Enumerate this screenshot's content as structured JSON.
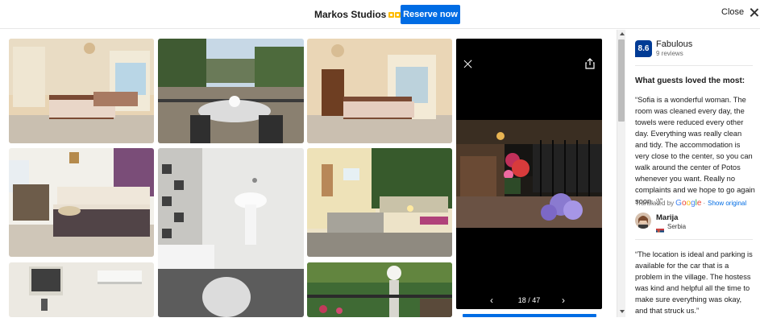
{
  "header": {
    "property_name": "Markos Studios",
    "star_rating": 3,
    "reserve_label": "Reserve now",
    "close_label": "Close"
  },
  "gallery": {
    "photos": [
      {
        "name": "photo-bedroom-1",
        "subject": "bedroom with curtains"
      },
      {
        "name": "photo-balcony",
        "subject": "balcony with tea set and hills"
      },
      {
        "name": "photo-bedroom-2",
        "subject": "bedroom with chandelier"
      },
      {
        "name": "photo-bedroom-3",
        "subject": "bedroom with floral bedding"
      },
      {
        "name": "photo-bathroom",
        "subject": "bathroom with sink and shower"
      },
      {
        "name": "photo-entrance",
        "subject": "entrance steps at night"
      },
      {
        "name": "photo-tv-room",
        "subject": "room with tv and air conditioner"
      },
      {
        "name": "photo-garden",
        "subject": "garden with lamp and flowers"
      }
    ]
  },
  "viewer": {
    "counter": "18 / 47",
    "image_subject": "terrace with flowers at night"
  },
  "reviews": {
    "score": "8.6",
    "score_word": "Fabulous",
    "review_count": "9 reviews",
    "loved_heading": "What guests loved the most:",
    "quote_1": "“Sofia is a wonderful woman. The room was cleaned every day, the towels were reduced every other day. Everything was really clean and tidy. The accommodation is very close to the center, so you can walk around the center of Potos whenever you want. Really no complaints and we hope to go again soon. :)”",
    "translated_by": "Translated by",
    "google_label": "Google",
    "show_original": "Show original",
    "reviewer_name": "Marija",
    "reviewer_country": "Serbia",
    "quote_2": "“The location is ideal and parking is available for the car that is a problem in the village. The hostess was kind and helpful all the time to make sure everything was okay, and that struck us.”"
  },
  "colors": {
    "accent": "#006ce4",
    "score_badge": "#003b95",
    "star": "#febb02"
  }
}
